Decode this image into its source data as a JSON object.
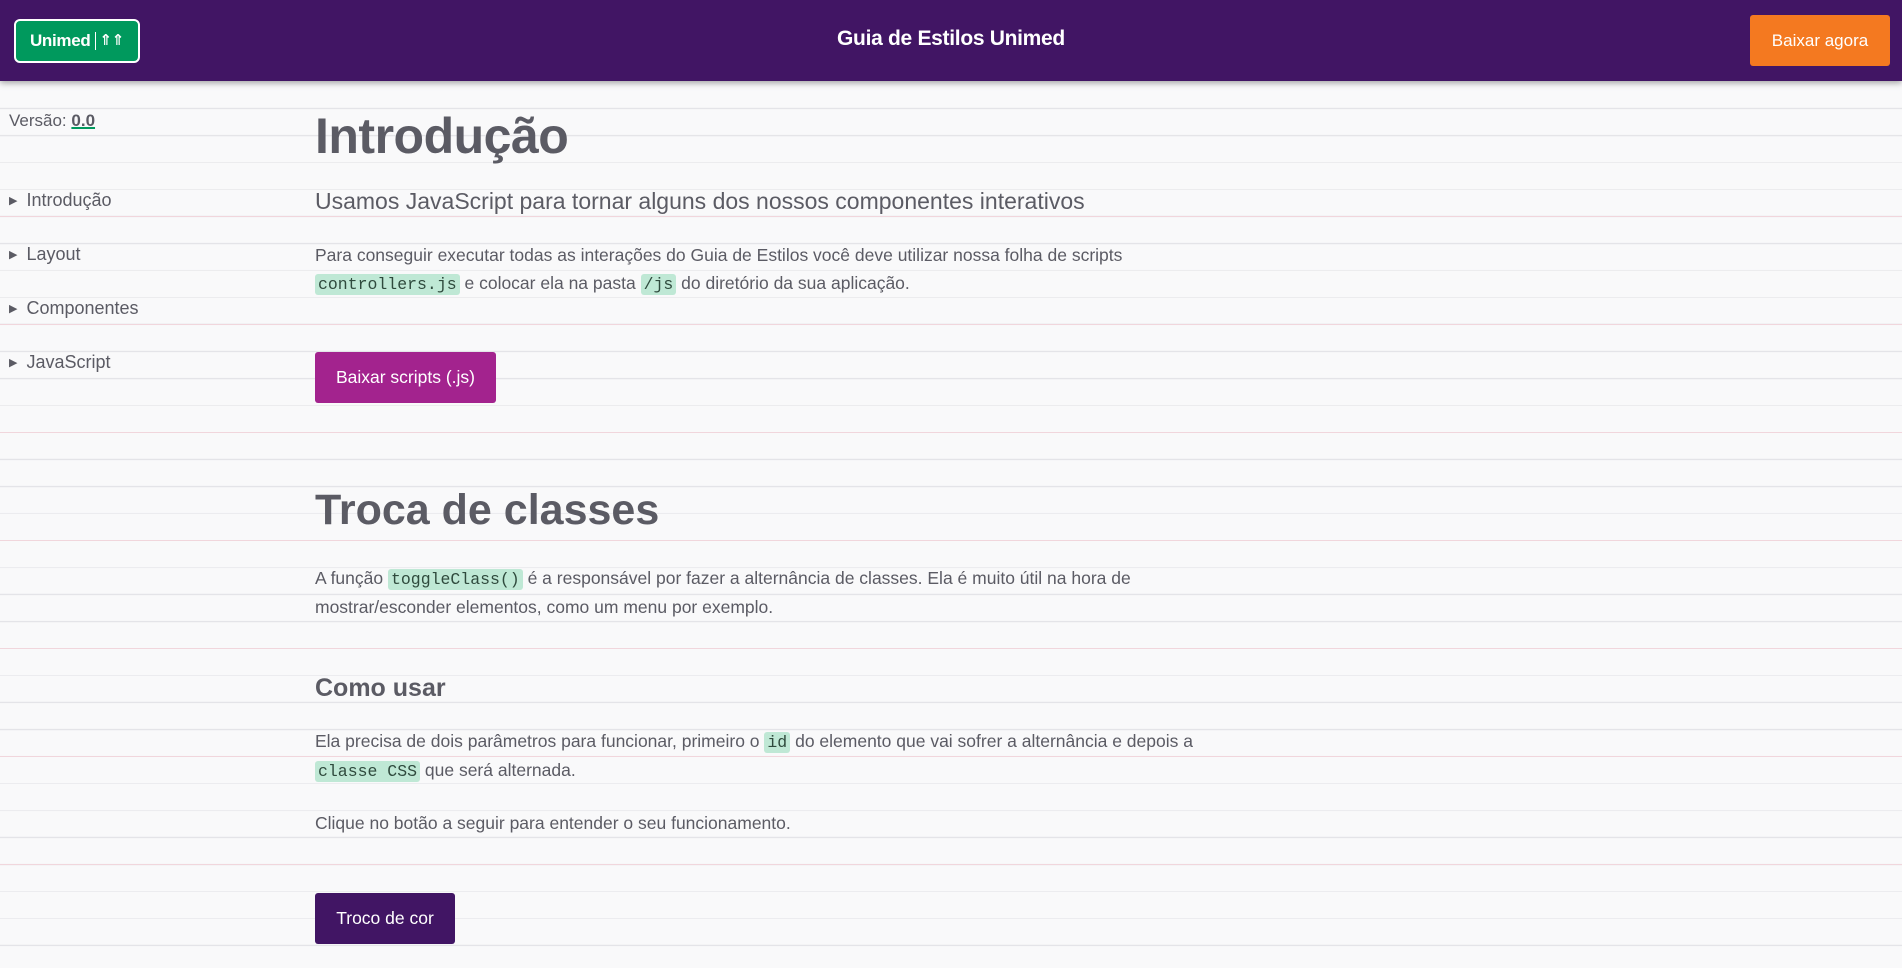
{
  "header": {
    "logo_text": "Unimed",
    "logo_mark": "⇑⇑",
    "title": "Guia de Estilos Unimed",
    "download_label": "Baixar agora"
  },
  "sidebar": {
    "version_label": "Versão:",
    "version_value": "0.0",
    "items": [
      {
        "label": "Introdução"
      },
      {
        "label": "Layout"
      },
      {
        "label": "Componentes"
      },
      {
        "label": "JavaScript"
      }
    ]
  },
  "main": {
    "title": "Introdução",
    "lead": "Usamos JavaScript para tornar alguns dos nossos componentes interativos",
    "intro": {
      "part1": "Para conseguir executar todas as interações do Guia de Estilos você deve utilizar nossa folha de scripts ",
      "code1": "controllers.js",
      "part2": " e colocar ela na pasta ",
      "code2": "/js",
      "part3": " do diretório da sua aplicação."
    },
    "download_scripts_label": "Baixar scripts (.js)",
    "section_title": "Troca de classes",
    "toggle": {
      "part1": "A função ",
      "code1": "toggleClass()",
      "part2": " é a responsável por fazer a alternância de classes. Ela é muito útil na hora de mostrar/esconder elementos, como um menu por exemplo."
    },
    "subsection_title": "Como usar",
    "usage": {
      "part1": "Ela precisa de dois parâmetros para funcionar, primeiro o ",
      "code1": "id",
      "part2": " do elemento que vai sofrer a alternância e depois a ",
      "code2": "classe CSS",
      "part3": " que será alternada."
    },
    "click_hint": "Clique no botão a seguir para entender o seu funcionamento.",
    "color_button_label": "Troco de cor"
  },
  "colors": {
    "header_bg": "#411564",
    "logo_green": "#00995d",
    "download_orange": "#f47920",
    "scripts_button": "#a3238e",
    "color_button": "#411564",
    "code_bg": "#bfe8d5"
  }
}
